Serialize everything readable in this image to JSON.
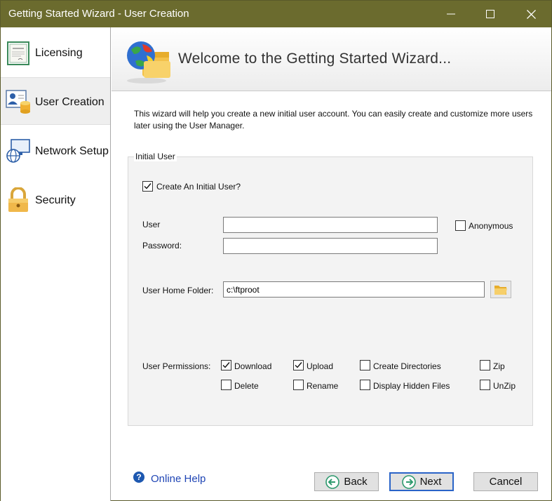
{
  "window": {
    "title": "Getting Started Wizard - User Creation",
    "controls": [
      "minimize-icon",
      "maximize-icon",
      "close-icon"
    ]
  },
  "sidebar": {
    "items": [
      {
        "label": "Licensing",
        "icon": "certificate-icon",
        "active": false
      },
      {
        "label": "User Creation",
        "icon": "user-database-icon",
        "active": true
      },
      {
        "label": "Network Setup",
        "icon": "network-icon",
        "active": false
      },
      {
        "label": "Security",
        "icon": "lock-icon",
        "active": false
      }
    ]
  },
  "header": {
    "title": "Welcome to the Getting Started Wizard...",
    "icon": "globe-folder-icon"
  },
  "intro": {
    "text": "This wizard will help you create a new initial user account.  You can easily create and customize more users later using the User Manager."
  },
  "initial_user": {
    "group_title": "Initial User",
    "create_label": "Create An Initial User?",
    "create_checked": true,
    "user_label": "User",
    "user_value": "",
    "password_label": "Password:",
    "password_value": "",
    "anonymous_label": "Anonymous",
    "anonymous_checked": false,
    "home_folder_label": "User Home Folder:",
    "home_folder_value": "c:\\ftproot",
    "permissions_label": "User Permissions:",
    "permissions": {
      "download": {
        "label": "Download",
        "checked": true
      },
      "upload": {
        "label": "Upload",
        "checked": true
      },
      "create_dirs": {
        "label": "Create Directories",
        "checked": false
      },
      "zip": {
        "label": "Zip",
        "checked": false
      },
      "delete": {
        "label": "Delete",
        "checked": false
      },
      "rename": {
        "label": "Rename",
        "checked": false
      },
      "display_hidden": {
        "label": "Display Hidden Files",
        "checked": false
      },
      "unzip": {
        "label": "UnZip",
        "checked": false
      }
    }
  },
  "footer": {
    "help_label": "Online Help",
    "back_label": "Back",
    "next_label": "Next",
    "cancel_label": "Cancel"
  },
  "colors": {
    "titlebar": "#6b6b2e",
    "link": "#1f45b5",
    "default_button_border": "#2a64c8",
    "nav_button_green": "#2e9a6e"
  }
}
